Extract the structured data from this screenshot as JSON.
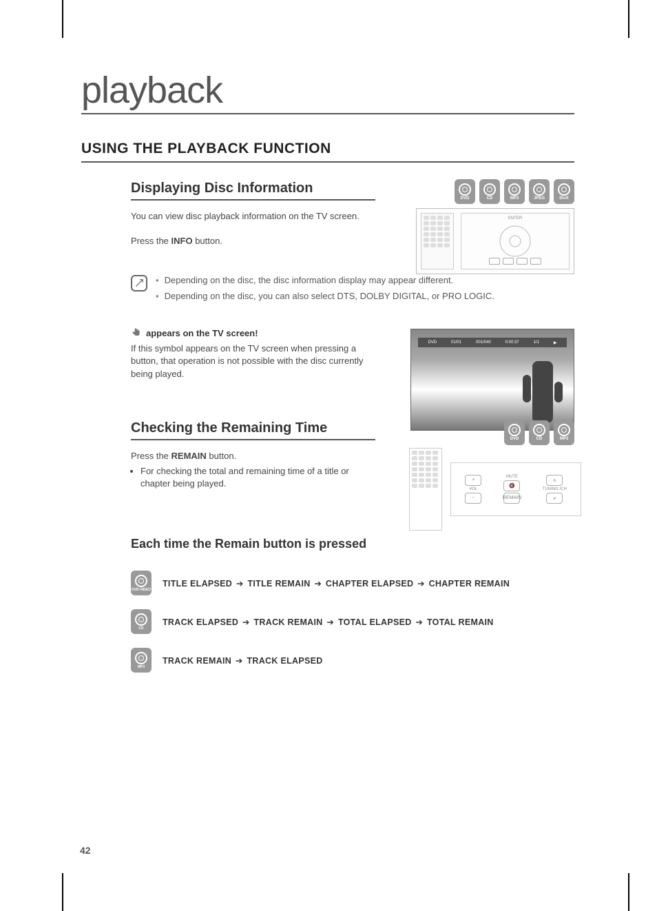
{
  "page_number": "42",
  "chapter_title": "playback",
  "section_title": "USING THE PLAYBACK FUNCTION",
  "disc_info": {
    "title": "Displaying Disc Information",
    "intro": "You can view disc playback information  on the TV screen.",
    "press_prefix": "Press the ",
    "press_button": "INFO",
    "press_suffix": " button.",
    "formats": [
      "DVD",
      "CD",
      "MP3",
      "JPEG",
      "DivX"
    ],
    "note1": "Depending on the disc, the disc information display may appear different.",
    "note2": "Depending on the disc, you can also select DTS, DOLBY DIGITAL, or PRO LOGIC.",
    "tv_heading": "appears on the TV screen!",
    "tv_desc": "If this symbol appears on the TV screen when pressing a button, that operation is not possible with the disc currently being played.",
    "infobar": {
      "dvd": "DVD",
      "t1": "01/01",
      "t2": "001/040",
      "time": "0:00:37",
      "audio": "1/1"
    },
    "remote_enter": "ENTER"
  },
  "remain": {
    "title": "Checking the Remaining Time",
    "press_prefix": "Press the ",
    "press_button": "REMAIN",
    "press_suffix": " button.",
    "bullet": "For checking the total and remaining time of a title or chapter being played.",
    "formats": [
      "DVD",
      "CD",
      "MP3"
    ],
    "buttons": {
      "vol": "VOL",
      "mute": "MUTE",
      "remain": "REMAIN",
      "tuning": "TUNING /CH"
    }
  },
  "sequence": {
    "heading": "Each time the Remain button is pressed",
    "rows": [
      {
        "badge": "DVD-VIDEO",
        "steps": [
          "TITLE ELAPSED",
          "TITLE REMAIN",
          "CHAPTER ELAPSED",
          "CHAPTER REMAIN"
        ]
      },
      {
        "badge": "CD",
        "steps": [
          "TRACK ELAPSED",
          "TRACK REMAIN",
          "TOTAL ELAPSED",
          "TOTAL REMAIN"
        ]
      },
      {
        "badge": "MP3",
        "steps": [
          "TRACK REMAIN",
          "TRACK ELAPSED"
        ]
      }
    ]
  }
}
